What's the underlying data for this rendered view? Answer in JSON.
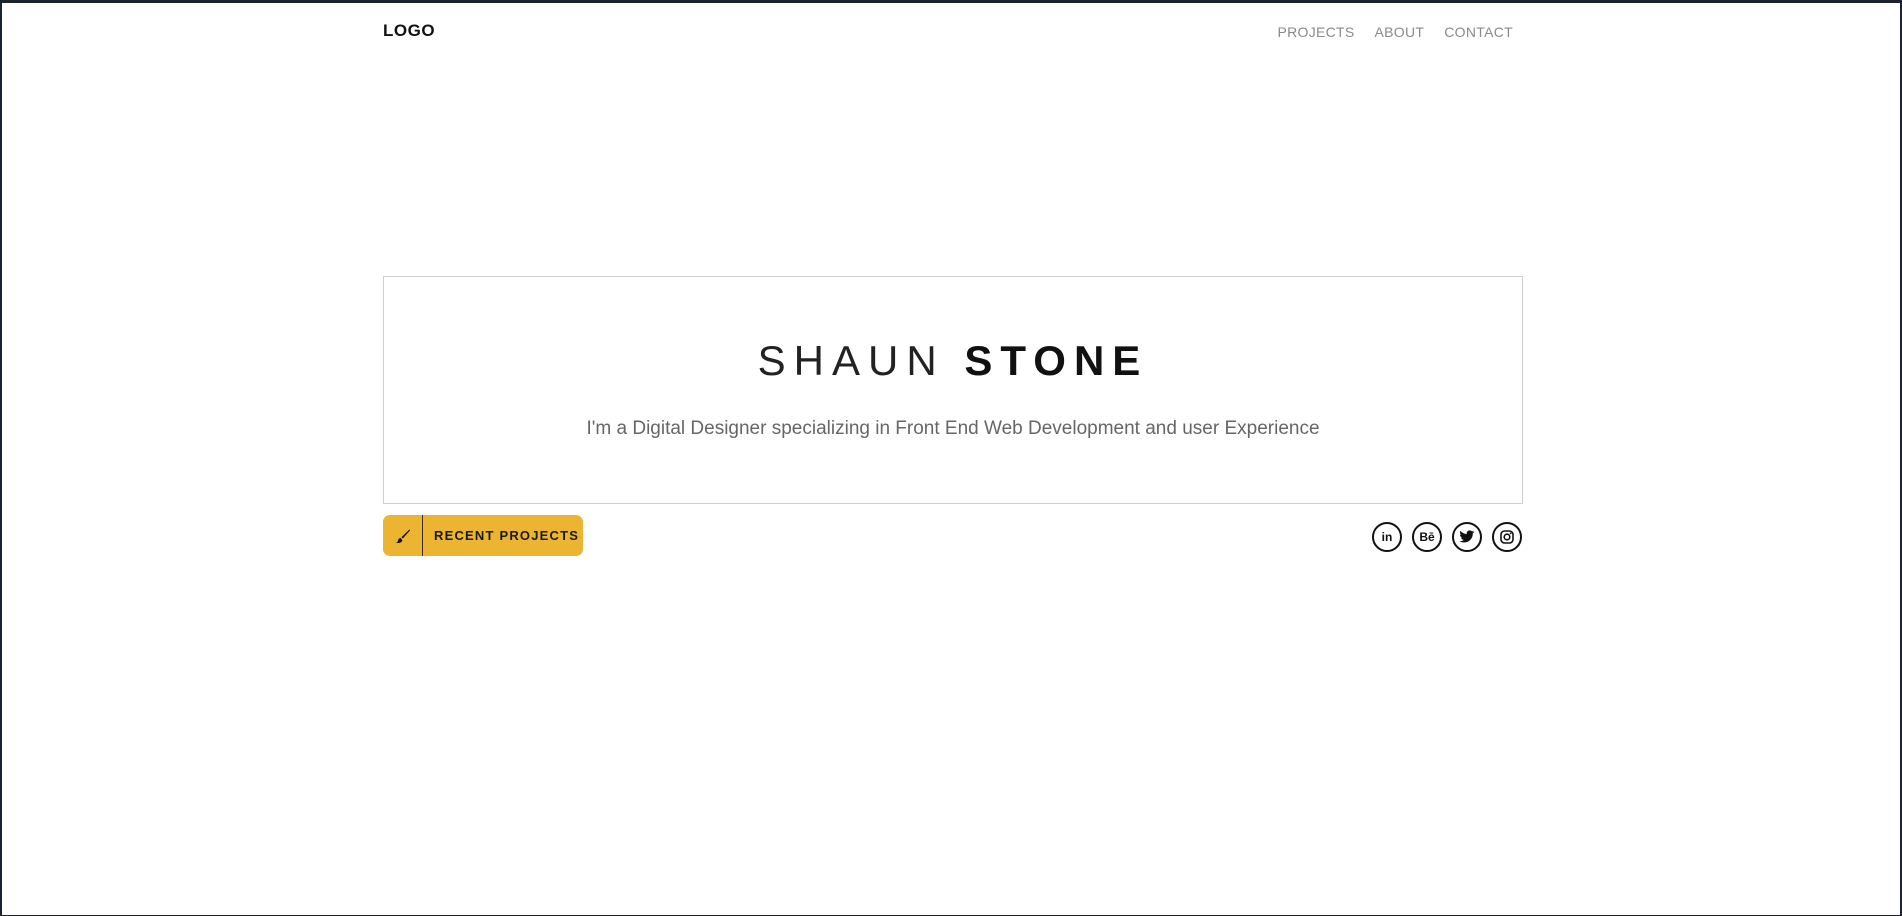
{
  "header": {
    "logo": "LOGO",
    "nav": [
      "PROJECTS",
      "ABOUT",
      "CONTACT"
    ]
  },
  "hero": {
    "first_name": "SHAUN",
    "last_name": "STONE",
    "tagline": "I'm a Digital Designer specializing in Front End Web Development and user Experience"
  },
  "cta": {
    "icon": "paintbrush-icon",
    "label": "RECENT PROJECTS",
    "color": "#ebb431"
  },
  "social": {
    "icons": [
      "linkedin-icon",
      "behance-icon",
      "twitter-icon",
      "instagram-icon"
    ],
    "linkedin_text": "in",
    "behance_text": "Bē"
  }
}
